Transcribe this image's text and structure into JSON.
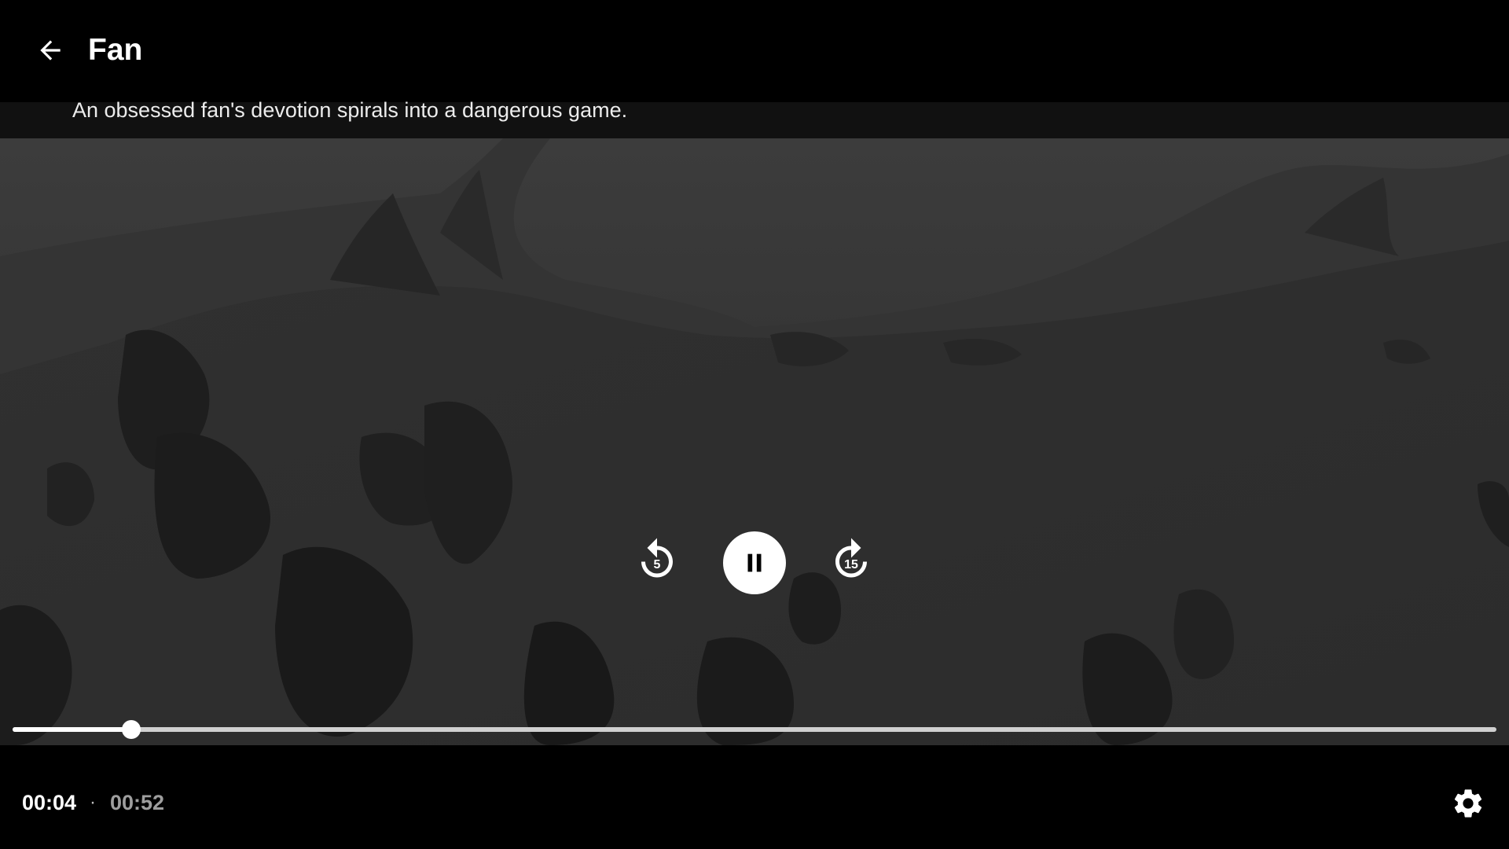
{
  "header": {
    "title": "Fan",
    "subtitle": "An obsessed fan's devotion spirals into a dangerous game.",
    "back_icon": "arrow-left-icon"
  },
  "playback": {
    "state": "playing",
    "rewind_seconds": "5",
    "forward_seconds": "15",
    "rewind_icon": "replay-icon",
    "pause_icon": "pause-icon",
    "forward_icon": "forward-icon"
  },
  "progress": {
    "current_time": "00:04",
    "separator": "·",
    "total_time": "00:52",
    "fraction": 0.08
  },
  "settings": {
    "icon": "gear-icon"
  },
  "colors": {
    "background": "#000000",
    "text": "#ffffff",
    "muted_text": "#9e9e9e",
    "track": "#d0d0d0",
    "subtitle_band": "#111111"
  }
}
